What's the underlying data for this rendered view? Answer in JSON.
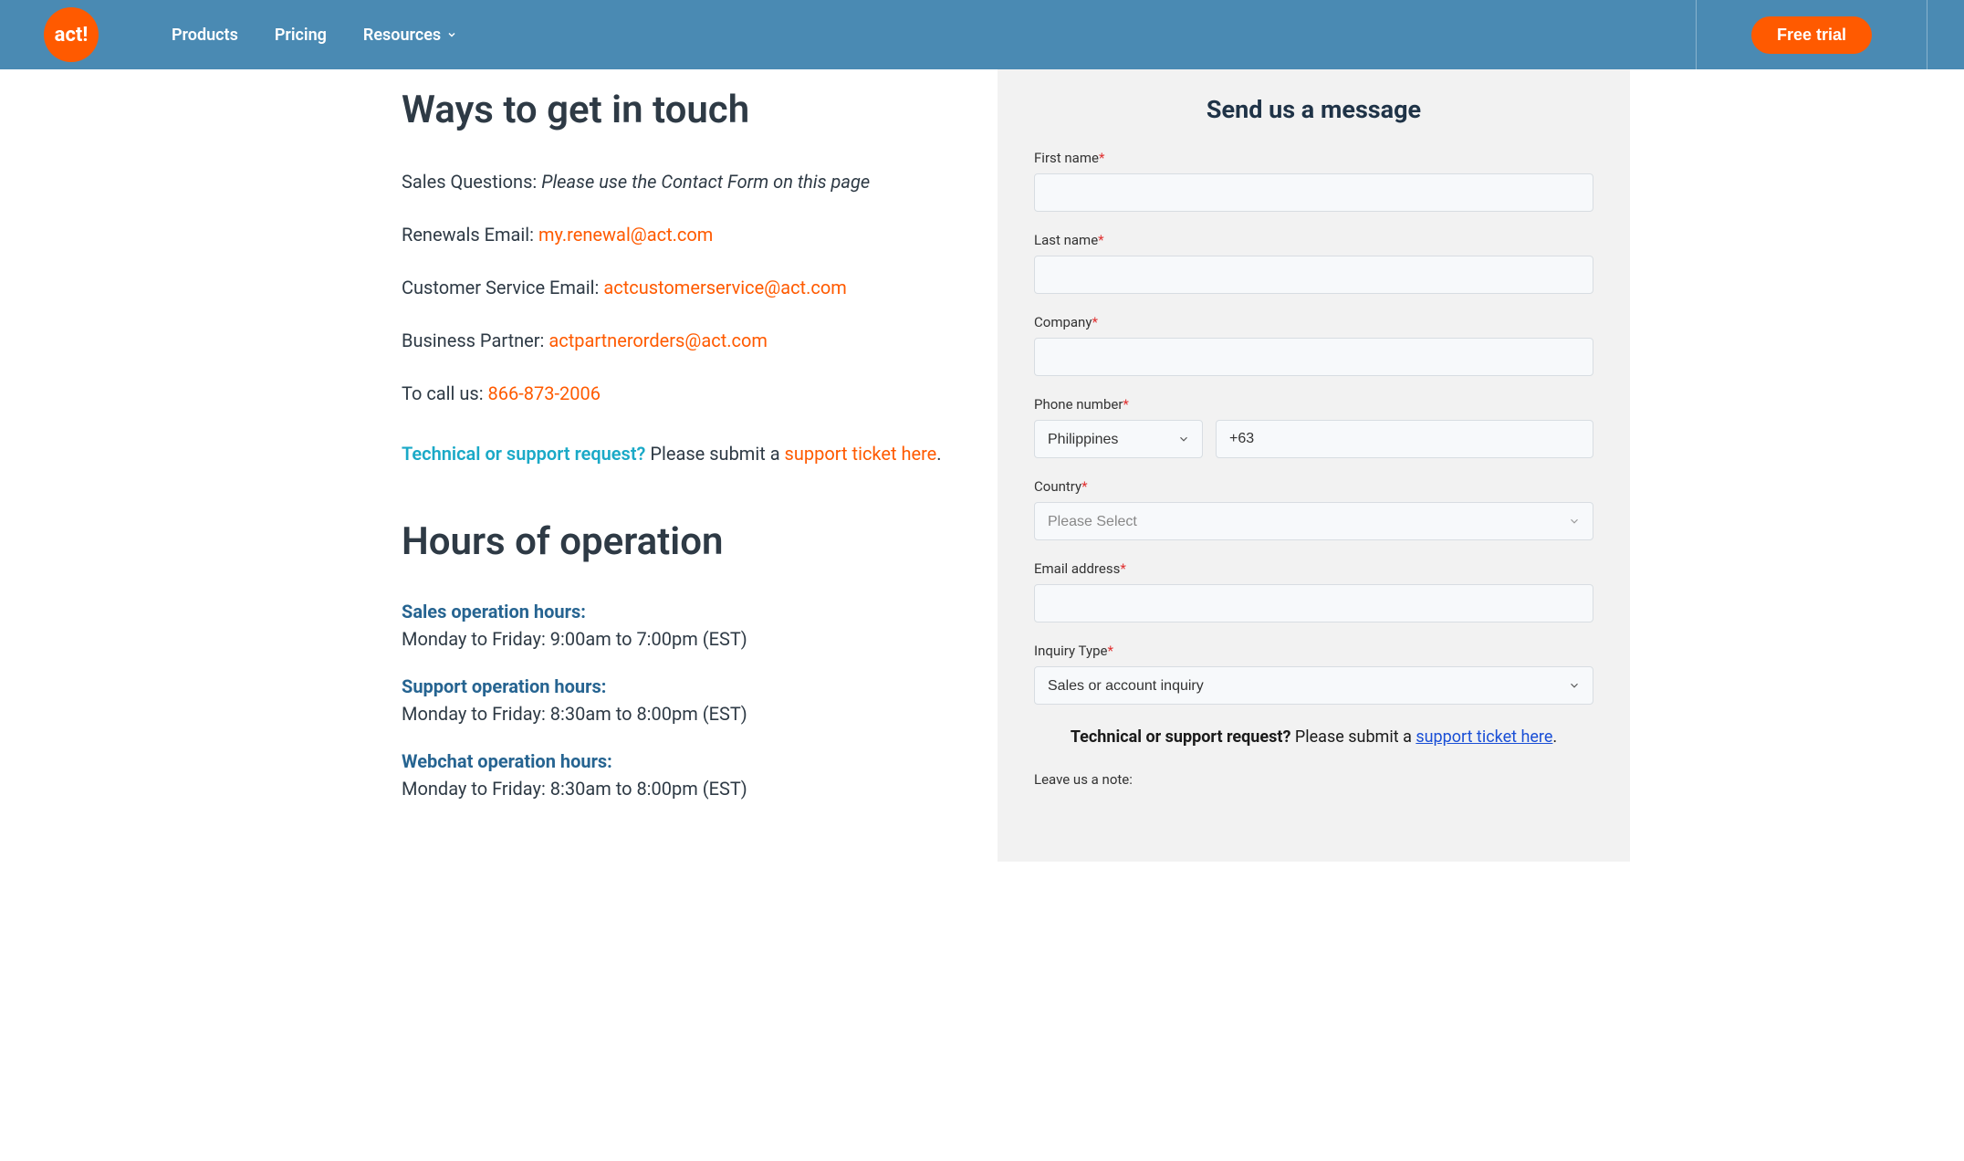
{
  "header": {
    "logo_text": "act!",
    "nav": [
      "Products",
      "Pricing",
      "Resources"
    ],
    "free_trial": "Free trial"
  },
  "left": {
    "ways_title": "Ways to get in touch",
    "sales_label": "Sales Questions: ",
    "sales_text": "Please use the Contact Form on this page",
    "renewals_label": "Renewals Email: ",
    "renewals_link": "my.renewal@act.com",
    "cs_label": "Customer Service Email: ",
    "cs_link": "actcustomerservice@act.com",
    "bp_label": "Business Partner: ",
    "bp_link": "actpartnerorders@act.com",
    "call_label": "To call us: ",
    "call_link": "866-873-2006",
    "tech_teal": "Technical or support request?",
    "tech_text": " Please submit a ",
    "tech_link": "support ticket here",
    "tech_period": ".",
    "hours_title": "Hours of operation",
    "hours": [
      {
        "heading": "Sales operation hours:",
        "text": "Monday to Friday: 9:00am to 7:00pm (EST)"
      },
      {
        "heading": "Support operation hours:",
        "text": "Monday to Friday: 8:30am to 8:00pm (EST)"
      },
      {
        "heading": "Webchat operation hours:",
        "text": "Monday to Friday: 8:30am to 8:00pm (EST)"
      }
    ]
  },
  "form": {
    "title": "Send us a message",
    "first_name_label": "First name",
    "last_name_label": "Last name",
    "company_label": "Company",
    "phone_label": "Phone number",
    "phone_country": "Philippines",
    "phone_code": "+63",
    "country_label": "Country",
    "country_placeholder": "Please Select",
    "email_label": "Email address",
    "inquiry_label": "Inquiry Type",
    "inquiry_value": "Sales or account inquiry",
    "note_bold": "Technical or support request?",
    "note_text": " Please submit a ",
    "note_link": "support ticket here",
    "note_period": ".",
    "leave_note_label": "Leave us a note:"
  }
}
